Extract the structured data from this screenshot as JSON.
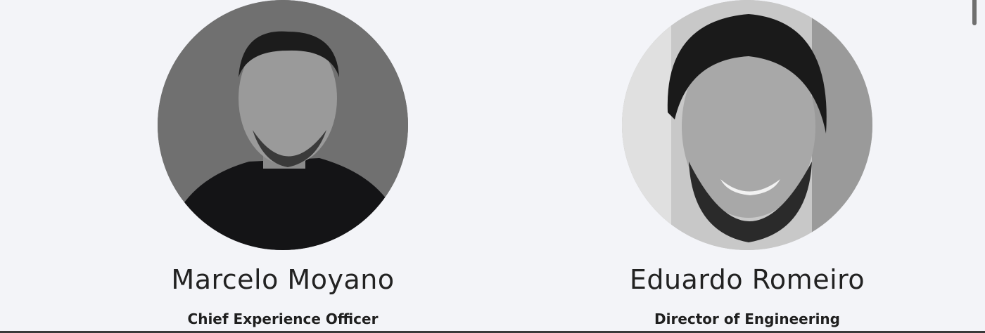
{
  "team": [
    {
      "name": "Marcelo Moyano",
      "role": "Chief Experience Officer",
      "photo_alt": "Marcelo Moyano portrait"
    },
    {
      "name": "Eduardo Romeiro",
      "role": "Director of Engineering",
      "photo_alt": "Eduardo Romeiro portrait"
    }
  ]
}
